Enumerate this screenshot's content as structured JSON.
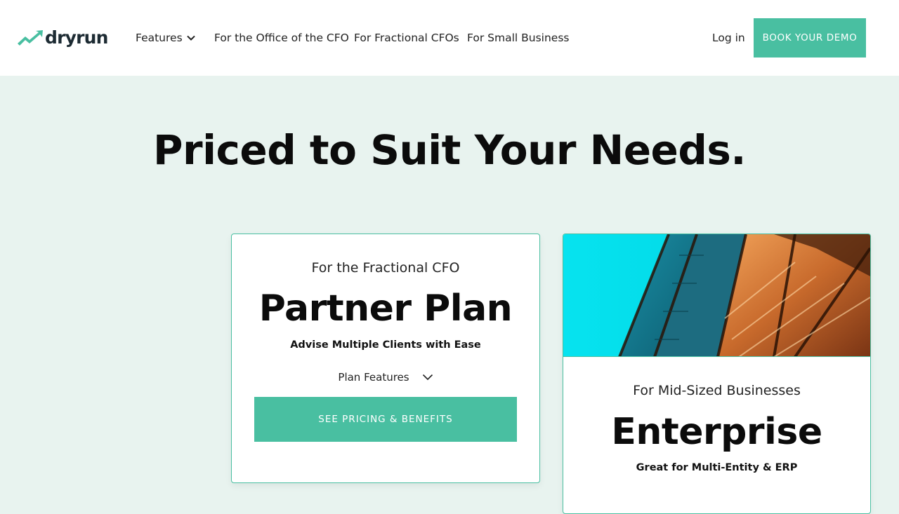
{
  "brand": {
    "name": "dryrun",
    "accent": "#49bfa1"
  },
  "nav": {
    "features_label": "Features",
    "links": [
      "For the Office of the CFO",
      "For Fractional CFOs",
      "For Small Business"
    ],
    "login_label": "Log in",
    "cta_label": "BOOK YOUR DEMO"
  },
  "hero": {
    "title": "Priced to Suit Your Needs."
  },
  "plans": [
    {
      "eyebrow": "For the Fractional CFO",
      "title": "Partner Plan",
      "subtitle": "Advise Multiple Clients with Ease",
      "features_toggle": "Plan Features",
      "button_label": "SEE PRICING & BENEFITS",
      "icon": "chevron-down-icon"
    },
    {
      "eyebrow": "For Mid-Sized Businesses",
      "title": "Enterprise",
      "subtitle": "Great for Multi-Entity & ERP",
      "image": "glass-building-facade-image"
    }
  ]
}
